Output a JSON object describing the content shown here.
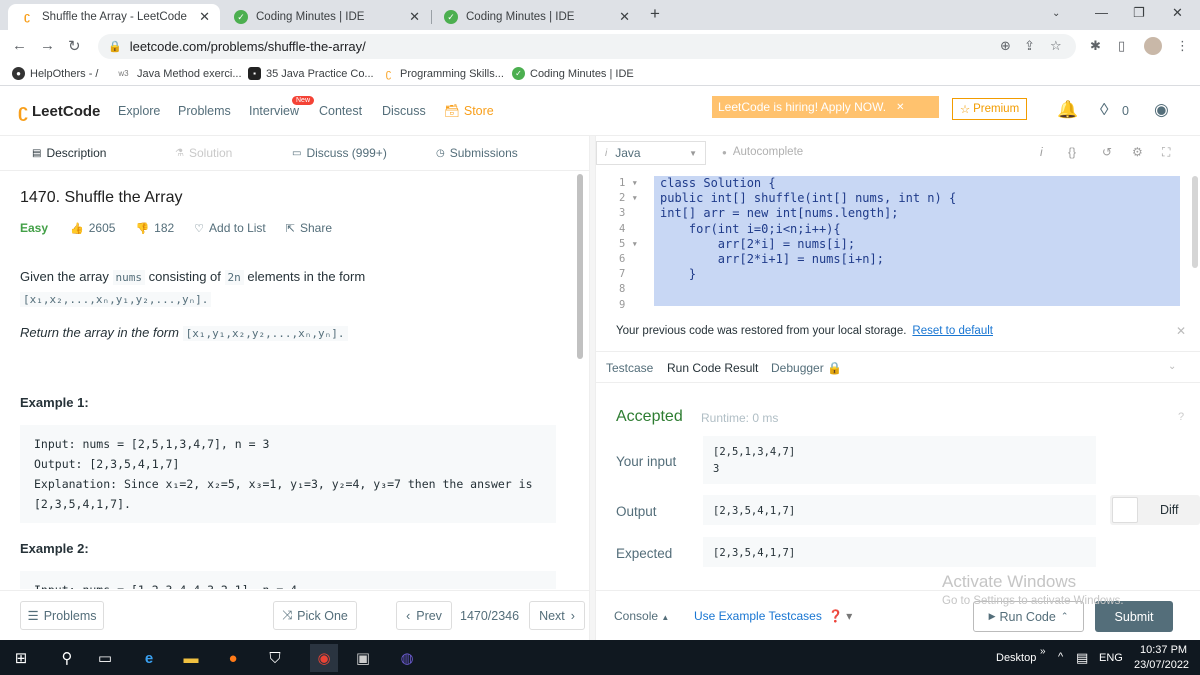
{
  "browser": {
    "tabs": [
      {
        "title": "Shuffle the Array - LeetCode",
        "active": true
      },
      {
        "title": "Coding Minutes | IDE",
        "active": false
      },
      {
        "title": "Coding Minutes | IDE",
        "active": false
      }
    ],
    "url": "leetcode.com/problems/shuffle-the-array/",
    "bookmarks": [
      "HelpOthers - /",
      "Java Method exerci...",
      "35 Java Practice Co...",
      "Programming Skills...",
      "Coding Minutes | IDE"
    ]
  },
  "nav": {
    "logo": "LeetCode",
    "links": [
      "Explore",
      "Problems",
      "Interview",
      "Contest",
      "Discuss",
      "Store"
    ],
    "new_badge": "New",
    "hiring": "LeetCode is hiring! Apply NOW.",
    "premium": "Premium",
    "coins": "0"
  },
  "left_tabs": [
    "Description",
    "Solution",
    "Discuss (999+)",
    "Submissions"
  ],
  "problem": {
    "title": "1470. Shuffle the Array",
    "difficulty": "Easy",
    "likes": "2605",
    "dislikes": "182",
    "add_to_list": "Add to List",
    "share": "Share",
    "para1_a": "Given the array",
    "para1_code1": "nums",
    "para1_b": "consisting of",
    "para1_code2": "2n",
    "para1_c": "elements in the form",
    "para1_form": "[x₁,x₂,...,xₙ,y₁,y₂,...,yₙ].",
    "para2_a": "Return the array in the form",
    "para2_form": "[x₁,y₁,x₂,y₂,...,xₙ,yₙ].",
    "example1_head": "Example 1:",
    "example1_lines": [
      "Input: nums = [2,5,1,3,4,7], n = 3",
      "Output: [2,3,5,4,1,7]",
      "Explanation: Since x₁=2, x₂=5, x₃=1, y₁=3, y₂=4, y₃=7 then the answer is",
      "[2,3,5,4,1,7]."
    ],
    "example2_head": "Example 2:",
    "example2_partial": "Input: nums = [1,2,3,4,4,3,2,1], n = 4"
  },
  "left_footer": {
    "problems": "Problems",
    "pick_one": "Pick One",
    "prev": "Prev",
    "counter": "1470/2346",
    "next": "Next"
  },
  "editor": {
    "language": "Java",
    "autocomplete": "Autocomplete",
    "line_numbers": [
      "1",
      "2",
      "3",
      "4",
      "5",
      "6",
      "7",
      "8",
      "9"
    ],
    "code_lines": [
      "class Solution {",
      "public int[] shuffle(int[] nums, int n) {",
      "int[] arr = new int[nums.length];",
      "",
      "    for(int i=0;i<n;i++){",
      "        arr[2*i] = nums[i];",
      "        arr[2*i+1] = nums[i+n];",
      "    }",
      ""
    ]
  },
  "notice": {
    "text": "Your previous code was restored from your local storage.",
    "reset": "Reset to default"
  },
  "result_tabs": [
    "Testcase",
    "Run Code Result",
    "Debugger"
  ],
  "result": {
    "status": "Accepted",
    "runtime": "Runtime: 0 ms",
    "your_input_label": "Your input",
    "your_input_lines": [
      "[2,5,1,3,4,7]",
      "3"
    ],
    "output_label": "Output",
    "output": "[2,3,5,4,1,7]",
    "expected_label": "Expected",
    "expected": "[2,3,5,4,1,7]",
    "diff": "Diff"
  },
  "right_footer": {
    "console": "Console",
    "use_example": "Use Example Testcases",
    "run_code": "Run Code",
    "submit": "Submit"
  },
  "watermark": {
    "line1": "Activate Windows",
    "line2": "Go to Settings to activate Windows."
  },
  "taskbar": {
    "desktop": "Desktop",
    "lang": "ENG",
    "time": "10:37 PM",
    "date": "23/07/2022"
  }
}
